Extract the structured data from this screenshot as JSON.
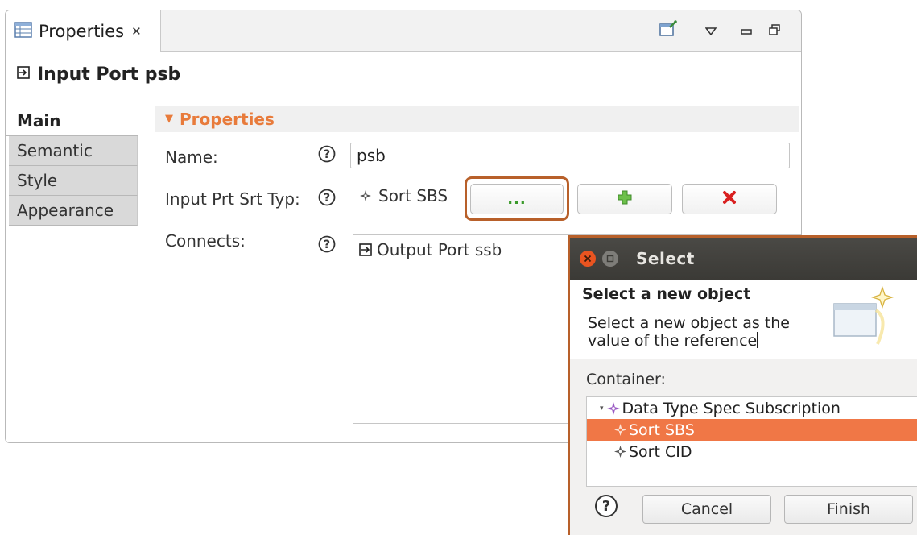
{
  "view": {
    "tab_label": "Properties",
    "header_title": "Input Port psb",
    "side_tabs": [
      "Main",
      "Semantic",
      "Style",
      "Appearance"
    ],
    "section_title": "Properties",
    "fields": {
      "name_label": "Name:",
      "name_value": "psb",
      "sort_type_label": "Input Prt Srt Typ:",
      "sort_type_value": "Sort SBS",
      "browse_label": "...",
      "connects_label": "Connects:",
      "connects_items": [
        "Output Port ssb"
      ]
    }
  },
  "dialog": {
    "title": "Select",
    "banner_title": "Select a new object",
    "banner_message": "Select a new object as the value of the reference",
    "container_label": "Container:",
    "tree": [
      {
        "label": "Data Type Spec Subscription",
        "level": 0,
        "expanded": true,
        "selected": false
      },
      {
        "label": "Sort SBS",
        "level": 1,
        "selected": true
      },
      {
        "label": "Sort CID",
        "level": 1,
        "selected": false
      }
    ],
    "cancel_label": "Cancel",
    "finish_label": "Finish"
  },
  "colors": {
    "accent": "#e87b3b",
    "selection": "#f07746",
    "highlight_border": "#b8602a",
    "ubuntu_close": "#e95420"
  },
  "icons": {
    "view_tab": "properties-table-icon",
    "header": "input-port-icon",
    "help": "help-icon",
    "add": "add-plus-icon",
    "remove": "remove-x-icon",
    "tree_item": "element-star-icon"
  }
}
